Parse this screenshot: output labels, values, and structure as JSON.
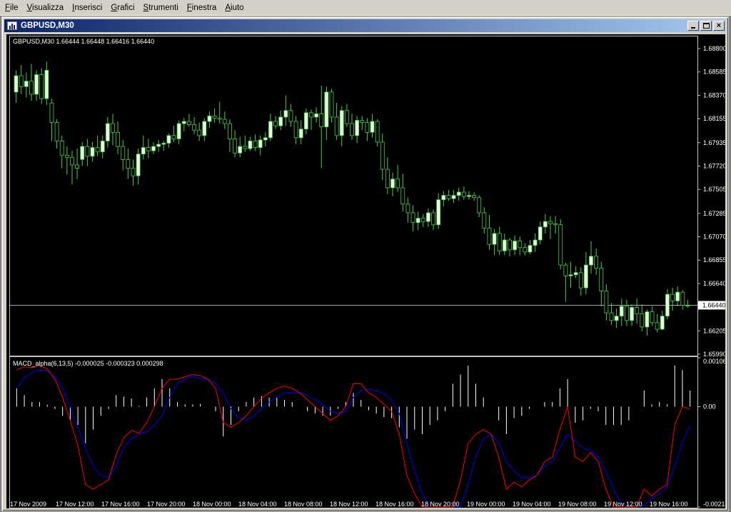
{
  "menu": [
    "File",
    "Visualizza",
    "Inserisci",
    "Grafici",
    "Strumenti",
    "Finestra",
    "Aiuto"
  ],
  "window": {
    "title": "GBPUSD,M30",
    "min_icon": "minimize-icon",
    "max_icon": "maximize-icon",
    "close_icon": "close-icon"
  },
  "chart_data": [
    {
      "type": "candlestick",
      "info": "GBPUSD,M30  1.66444 1.66448 1.66416 1.66440",
      "ylim": [
        1.6599,
        1.688
      ],
      "y_ticks": [
        "1.68800",
        "1.68585",
        "1.68370",
        "1.68155",
        "1.67935",
        "1.67720",
        "1.67505",
        "1.67285",
        "1.67070",
        "1.66855",
        "1.66640",
        "1.66205",
        "1.65990"
      ],
      "current_price": "1.66440",
      "colors": {
        "up": "#e8ffe0",
        "down": "#000000",
        "wick": "#46d246",
        "grid": "#c0c0c0"
      },
      "candles": [
        [
          1.684,
          1.686,
          1.683,
          1.6855
        ],
        [
          1.6855,
          1.6865,
          1.6838,
          1.6845
        ],
        [
          1.6845,
          1.6858,
          1.6835,
          1.685
        ],
        [
          1.685,
          1.6866,
          1.6832,
          1.6838
        ],
        [
          1.6838,
          1.686,
          1.6832,
          1.6856
        ],
        [
          1.6856,
          1.6862,
          1.6829,
          1.6834
        ],
        [
          1.6834,
          1.6868,
          1.6828,
          1.686
        ],
        [
          1.683,
          1.6834,
          1.6795,
          1.6812
        ],
        [
          1.6812,
          1.6815,
          1.6788,
          1.6795
        ],
        [
          1.6795,
          1.68,
          1.677,
          1.6782
        ],
        [
          1.6782,
          1.679,
          1.6764,
          1.678
        ],
        [
          1.678,
          1.6786,
          1.6755,
          1.6773
        ],
        [
          1.6773,
          1.6788,
          1.676,
          1.677
        ],
        [
          1.6778,
          1.6794,
          1.6772,
          1.679
        ],
        [
          1.679,
          1.6797,
          1.6772,
          1.6781
        ],
        [
          1.6781,
          1.6794,
          1.6776,
          1.6789
        ],
        [
          1.6789,
          1.68,
          1.6781,
          1.6785
        ],
        [
          1.6785,
          1.68,
          1.6779,
          1.6795
        ],
        [
          1.6795,
          1.6817,
          1.6789,
          1.6811
        ],
        [
          1.6811,
          1.682,
          1.6791,
          1.6803
        ],
        [
          1.6803,
          1.6813,
          1.6783,
          1.679
        ],
        [
          1.679,
          1.6796,
          1.6768,
          1.6778
        ],
        [
          1.6778,
          1.6788,
          1.676,
          1.677
        ],
        [
          1.677,
          1.6778,
          1.6754,
          1.6763
        ],
        [
          1.6763,
          1.6788,
          1.6755,
          1.6783
        ],
        [
          1.6783,
          1.68,
          1.6778,
          1.6789
        ],
        [
          1.6789,
          1.6797,
          1.6779,
          1.6786
        ],
        [
          1.6786,
          1.6794,
          1.6783,
          1.679
        ],
        [
          1.679,
          1.6796,
          1.6785,
          1.6792
        ],
        [
          1.6792,
          1.6795,
          1.6786,
          1.6793
        ],
        [
          1.6793,
          1.6802,
          1.6789,
          1.68
        ],
        [
          1.68,
          1.6809,
          1.6794,
          1.6797
        ],
        [
          1.6797,
          1.6814,
          1.6792,
          1.6811
        ],
        [
          1.6811,
          1.6816,
          1.6804,
          1.6813
        ],
        [
          1.6813,
          1.682,
          1.6808,
          1.681
        ],
        [
          1.681,
          1.6817,
          1.6801,
          1.6805
        ],
        [
          1.6805,
          1.6812,
          1.6795,
          1.68
        ],
        [
          1.68,
          1.6816,
          1.6795,
          1.6813
        ],
        [
          1.6813,
          1.6822,
          1.6807,
          1.6818
        ],
        [
          1.6818,
          1.6825,
          1.6812,
          1.6816
        ],
        [
          1.6816,
          1.6831,
          1.6811,
          1.6815
        ],
        [
          1.6815,
          1.6822,
          1.6806,
          1.6811
        ],
        [
          1.6811,
          1.6815,
          1.6785,
          1.6797
        ],
        [
          1.6797,
          1.6805,
          1.678,
          1.6784
        ],
        [
          1.6784,
          1.6799,
          1.678,
          1.679
        ],
        [
          1.679,
          1.68,
          1.6785,
          1.6788
        ],
        [
          1.6788,
          1.6799,
          1.6786,
          1.6795
        ],
        [
          1.6795,
          1.6801,
          1.6786,
          1.6789
        ],
        [
          1.6789,
          1.68,
          1.6782,
          1.6796
        ],
        [
          1.6796,
          1.6803,
          1.679,
          1.6798
        ],
        [
          1.6798,
          1.682,
          1.6795,
          1.6813
        ],
        [
          1.6813,
          1.6818,
          1.6806,
          1.6809
        ],
        [
          1.6809,
          1.6823,
          1.6805,
          1.6817
        ],
        [
          1.6817,
          1.6837,
          1.6809,
          1.6823
        ],
        [
          1.6823,
          1.6829,
          1.6808,
          1.6813
        ],
        [
          1.6813,
          1.6818,
          1.6792,
          1.6798
        ],
        [
          1.6798,
          1.6814,
          1.6792,
          1.6806
        ],
        [
          1.6806,
          1.6825,
          1.6801,
          1.6821
        ],
        [
          1.6821,
          1.6824,
          1.6805,
          1.6817
        ],
        [
          1.6817,
          1.6826,
          1.6812,
          1.682
        ],
        [
          1.682,
          1.6846,
          1.677,
          1.6808
        ],
        [
          1.6808,
          1.6845,
          1.6796,
          1.684
        ],
        [
          1.684,
          1.6843,
          1.6812,
          1.6817
        ],
        [
          1.6817,
          1.683,
          1.6796,
          1.68
        ],
        [
          1.68,
          1.6827,
          1.679,
          1.6823
        ],
        [
          1.6823,
          1.6829,
          1.6808,
          1.6811
        ],
        [
          1.6811,
          1.682,
          1.6796,
          1.68
        ],
        [
          1.68,
          1.6818,
          1.6793,
          1.6814
        ],
        [
          1.6814,
          1.6818,
          1.6805,
          1.6812
        ],
        [
          1.6812,
          1.6816,
          1.6795,
          1.6803
        ],
        [
          1.6803,
          1.682,
          1.6798,
          1.6813
        ],
        [
          1.6813,
          1.6815,
          1.679,
          1.6794
        ],
        [
          1.6794,
          1.6802,
          1.6759,
          1.6769
        ],
        [
          1.6769,
          1.678,
          1.6746,
          1.6752
        ],
        [
          1.6752,
          1.6766,
          1.6744,
          1.676
        ],
        [
          1.676,
          1.6773,
          1.6748,
          1.6752
        ],
        [
          1.6752,
          1.6765,
          1.673,
          1.6737
        ],
        [
          1.6737,
          1.6743,
          1.672,
          1.6729
        ],
        [
          1.6729,
          1.6736,
          1.6712,
          1.672
        ],
        [
          1.672,
          1.673,
          1.6713,
          1.6724
        ],
        [
          1.6724,
          1.6728,
          1.6716,
          1.6721
        ],
        [
          1.6721,
          1.6733,
          1.6716,
          1.6729
        ],
        [
          1.6729,
          1.6732,
          1.6713,
          1.6718
        ],
        [
          1.6718,
          1.6747,
          1.6714,
          1.6741
        ],
        [
          1.6741,
          1.6749,
          1.6735,
          1.6745
        ],
        [
          1.6745,
          1.675,
          1.674,
          1.6742
        ],
        [
          1.6742,
          1.675,
          1.6738,
          1.6745
        ],
        [
          1.6745,
          1.6752,
          1.674,
          1.6748
        ],
        [
          1.6748,
          1.6753,
          1.6741,
          1.6744
        ],
        [
          1.6744,
          1.6749,
          1.6741,
          1.6745
        ],
        [
          1.6745,
          1.6748,
          1.674,
          1.6743
        ],
        [
          1.6743,
          1.6745,
          1.6725,
          1.6729
        ],
        [
          1.6729,
          1.6734,
          1.671,
          1.6715
        ],
        [
          1.6715,
          1.6727,
          1.6695,
          1.67
        ],
        [
          1.67,
          1.6714,
          1.669,
          1.671
        ],
        [
          1.671,
          1.6716,
          1.669,
          1.6694
        ],
        [
          1.6694,
          1.671,
          1.669,
          1.6704
        ],
        [
          1.6704,
          1.6706,
          1.6689,
          1.6695
        ],
        [
          1.6695,
          1.6708,
          1.669,
          1.6703
        ],
        [
          1.6703,
          1.6707,
          1.669,
          1.6697
        ],
        [
          1.6697,
          1.6701,
          1.669,
          1.6693
        ],
        [
          1.6693,
          1.6704,
          1.6691,
          1.6699
        ],
        [
          1.6699,
          1.671,
          1.6693,
          1.6704
        ],
        [
          1.6704,
          1.6721,
          1.67,
          1.6716
        ],
        [
          1.6716,
          1.6728,
          1.671,
          1.6721
        ],
        [
          1.6721,
          1.6726,
          1.6705,
          1.6719
        ],
        [
          1.6719,
          1.6726,
          1.671,
          1.6718
        ],
        [
          1.6718,
          1.6723,
          1.6677,
          1.6681
        ],
        [
          1.6681,
          1.6683,
          1.6647,
          1.6671
        ],
        [
          1.6671,
          1.6684,
          1.666,
          1.6672
        ],
        [
          1.6672,
          1.668,
          1.6669,
          1.6674
        ],
        [
          1.6674,
          1.6679,
          1.6653,
          1.666
        ],
        [
          1.666,
          1.6693,
          1.6654,
          1.6681
        ],
        [
          1.6681,
          1.6703,
          1.6673,
          1.6689
        ],
        [
          1.6689,
          1.6696,
          1.6672,
          1.6678
        ],
        [
          1.6678,
          1.6684,
          1.6643,
          1.6657
        ],
        [
          1.6657,
          1.6663,
          1.663,
          1.6637
        ],
        [
          1.6637,
          1.6646,
          1.6626,
          1.663
        ],
        [
          1.663,
          1.6641,
          1.6623,
          1.6634
        ],
        [
          1.6634,
          1.665,
          1.6625,
          1.6643
        ],
        [
          1.6643,
          1.6649,
          1.6625,
          1.663
        ],
        [
          1.663,
          1.6645,
          1.6625,
          1.6642
        ],
        [
          1.6642,
          1.665,
          1.6627,
          1.6636
        ],
        [
          1.6636,
          1.6645,
          1.662,
          1.6624
        ],
        [
          1.6624,
          1.664,
          1.6616,
          1.6638
        ],
        [
          1.6638,
          1.6643,
          1.6625,
          1.6628
        ],
        [
          1.6628,
          1.6636,
          1.6619,
          1.6622
        ],
        [
          1.6622,
          1.6639,
          1.6621,
          1.6634
        ],
        [
          1.6634,
          1.6659,
          1.6631,
          1.6654
        ],
        [
          1.6654,
          1.666,
          1.6639,
          1.6648
        ],
        [
          1.6648,
          1.6661,
          1.6643,
          1.6656
        ],
        [
          1.6656,
          1.6658,
          1.664,
          1.6644
        ],
        [
          1.6644,
          1.6649,
          1.6642,
          1.6644
        ]
      ]
    },
    {
      "type": "line",
      "info": "MACD_alpha(6,13,5) -0.000025 -0.000323 0.000298",
      "ylim": [
        -0.00219,
        0.001067
      ],
      "y_ticks": [
        "0.001067",
        "0.00",
        "-0.00219"
      ],
      "x_ticks": [
        "17 Nov 2009",
        "17 Nov 12:00",
        "17 Nov 16:00",
        "17 Nov 20:00",
        "18 Nov 00:00",
        "18 Nov 04:00",
        "18 Nov 08:00",
        "18 Nov 12:00",
        "18 Nov 16:00",
        "18 Nov 20:00",
        "19 Nov 00:00",
        "19 Nov 04:00",
        "19 Nov 08:00",
        "19 Nov 12:00",
        "19 Nov 16:00"
      ],
      "series": [
        {
          "color": "#ff0000",
          "values": [
            0.0008,
            0.00087,
            0.00085,
            0.0009,
            0.00082,
            0.0006,
            0.0002,
            -0.0003,
            -0.00085,
            -0.0017,
            -0.0018,
            -0.0017,
            -0.0016,
            -0.00105,
            -0.00068,
            -0.00052,
            -0.00058,
            -0.00035,
            0.0,
            0.0004,
            0.0006,
            0.0006,
            0.00065,
            0.0007,
            0.00068,
            0.0006,
            0.0004,
            -0.00035,
            -0.00045,
            -0.00035,
            -0.0002,
            0.0,
            0.00018,
            0.0003,
            0.0004,
            0.00045,
            0.0004,
            0.0003,
            0.00015,
            0.0,
            -0.00015,
            -0.0003,
            -0.0002,
            0.0,
            0.0005,
            0.0005,
            0.0003,
            0.0002,
            5e-05,
            -0.0001,
            -0.0006,
            -0.0015,
            -0.0019,
            -0.0025,
            -0.0027,
            -0.003,
            -0.003,
            -0.0022,
            -0.0016,
            -0.0008,
            -0.0006,
            -0.0005,
            -0.0006,
            -0.0011,
            -0.0018,
            -0.00165,
            -0.00175,
            -0.0016,
            -0.0015,
            -0.0012,
            -0.0011,
            -0.0005,
            0.0,
            -0.0011,
            -0.0012,
            -0.001,
            -0.0012,
            -0.0018,
            -0.0022,
            -0.0025,
            -0.0026,
            -0.0023,
            -0.0018,
            -0.00195,
            -0.0018,
            -0.0017,
            -0.0004,
            0.0,
            -5e-05
          ]
        },
        {
          "color": "#0000ff",
          "values": [
            0.0004,
            0.00062,
            0.00075,
            0.0008,
            0.00078,
            0.00065,
            0.0004,
            0.0,
            -0.00045,
            -0.0009,
            -0.0013,
            -0.0015,
            -0.00155,
            -0.0013,
            -0.0009,
            -0.0007,
            -0.0006,
            -0.00055,
            -0.0004,
            -0.0002,
            0.0002,
            0.0005,
            0.0006,
            0.00065,
            0.00062,
            0.0006,
            0.0005,
            0.0003,
            -5e-05,
            -0.00025,
            -0.0003,
            -0.0002,
            -5e-05,
            0.0001,
            0.0002,
            0.0003,
            0.0003,
            0.0003,
            0.00025,
            0.00015,
            5e-05,
            -0.0001,
            -0.00015,
            -0.0001,
            0.0002,
            0.00035,
            0.00038,
            0.00035,
            0.00028,
            0.00015,
            -0.00015,
            -0.0008,
            -0.0014,
            -0.0019,
            -0.0023,
            -0.0027,
            -0.0029,
            -0.0027,
            -0.0023,
            -0.0017,
            -0.0011,
            -0.0007,
            -0.0006,
            -0.0008,
            -0.0012,
            -0.0014,
            -0.00155,
            -0.00155,
            -0.0015,
            -0.0013,
            -0.0012,
            -0.0009,
            -0.0006,
            -0.00075,
            -0.0009,
            -0.00095,
            -0.0011,
            -0.0014,
            -0.0018,
            -0.0021,
            -0.0023,
            -0.0023,
            -0.00215,
            -0.002,
            -0.0019,
            -0.00175,
            -0.0013,
            -0.0008,
            -0.0004
          ]
        },
        {
          "color": "#ffffff",
          "values": [
            0.0004,
            0.00025,
            0.0001,
            0.0001,
            4e-05,
            -5e-05,
            -0.0002,
            -0.0003,
            -0.0004,
            -0.0008,
            -0.0005,
            -0.0002,
            -5e-05,
            0.00025,
            0.00022,
            0.00018,
            2e-05,
            0.0002,
            0.0004,
            0.0006,
            0.0004,
            0.0001,
            5e-05,
            5e-05,
            6e-05,
            0.0,
            -0.0001,
            -0.00065,
            -0.0004,
            -0.0001,
            0.0001,
            0.0002,
            0.00023,
            0.0002,
            0.0002,
            0.00015,
            0.0001,
            0.0,
            -0.0001,
            -0.00015,
            -0.0002,
            -0.0002,
            -5e-05,
            0.0001,
            0.0003,
            0.00015,
            -8e-05,
            -0.00015,
            -0.00023,
            -0.00025,
            -0.00045,
            -0.0007,
            -0.0005,
            -0.0006,
            -0.0004,
            -0.0003,
            -0.0001,
            0.0005,
            0.0007,
            0.0009,
            0.0005,
            0.0002,
            0.0,
            -0.0003,
            -0.0006,
            -0.00025,
            -0.0002,
            -5e-05,
            0.0,
            0.0001,
            0.0001,
            0.0004,
            0.0006,
            -0.00035,
            -0.0003,
            -5e-05,
            -0.0001,
            -0.0004,
            -0.0004,
            -0.0004,
            -0.0003,
            0.0,
            0.00035,
            5e-05,
            0.0001,
            5e-05,
            0.0009,
            0.0008,
            0.00035
          ]
        }
      ]
    }
  ]
}
